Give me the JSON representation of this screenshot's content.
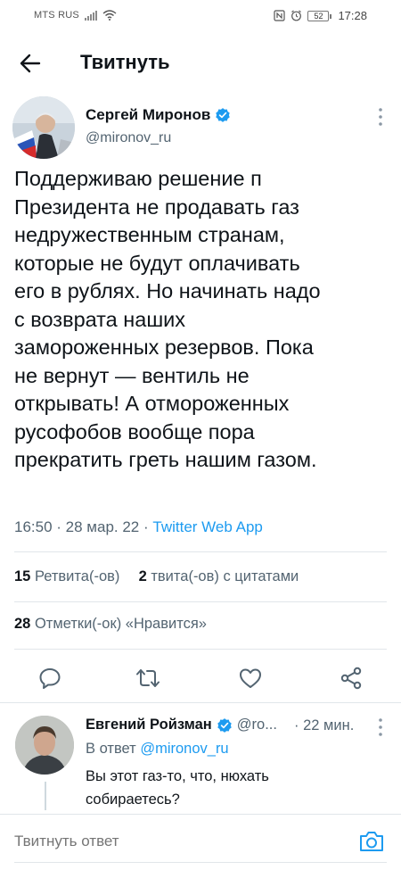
{
  "status_bar": {
    "carrier": "MTS RUS",
    "battery": "52",
    "time": "17:28"
  },
  "header": {
    "title": "Твитнуть"
  },
  "tweet": {
    "author_name": "Сергей Миронов",
    "handle": "@mironov_ru",
    "text": "Поддерживаю решение п\nПрезидента не продавать газ\nнедружественным странам,\nкоторые не будут оплачивать\nего в рублях. Но начинать надо\nс возврата наших\nзамороженных резервов. Пока\nне вернут — вентиль не\nоткрывать! А отмороженных\nрусофобов вообще пора\nпрекратить греть нашим газом.",
    "time": "16:50",
    "date": "28 мар. 22",
    "source": "Twitter Web App",
    "retweets_count": "15",
    "retweets_label": "Ретвита(-ов)",
    "quotes_count": "2",
    "quotes_label": "твита(-ов) с цитатами",
    "likes_count": "28",
    "likes_label": "Отметки(-ок) «Нравится»"
  },
  "reply": {
    "author_name": "Евгений Ройзман",
    "handle": "@ro...",
    "time": "· 22 мин.",
    "reply_to_prefix": "В ответ",
    "reply_to_handle": "@mironov_ru",
    "text": "Вы этот газ-то, что, нюхать собираетесь?"
  },
  "compose": {
    "placeholder": "Твитнуть ответ"
  },
  "colors": {
    "accent": "#1d9bf0",
    "text": "#0f1419",
    "secondary": "#536471"
  },
  "icons": {
    "back": "arrow-left-icon",
    "verified": "verified-badge-icon",
    "more": "more-vertical-icon",
    "reply": "comment-icon",
    "retweet": "retweet-icon",
    "like": "heart-icon",
    "share": "share-icon",
    "camera": "camera-icon"
  }
}
